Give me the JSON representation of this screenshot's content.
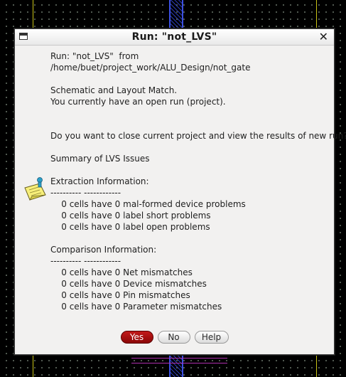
{
  "dialog": {
    "title": "Run: \"not_LVS\"",
    "lines": [
      "Run: \"not_LVS\"  from",
      "/home/buet/project_work/ALU_Design/not_gate",
      "",
      "Schematic and Layout Match.",
      "You currently have an open run (project).",
      "",
      "",
      "Do you want to close current project and view the results of new run?",
      "",
      "Summary of LVS Issues",
      "",
      "Extraction Information:",
      "---------- ------------",
      "    0 cells have 0 mal-formed device problems",
      "    0 cells have 0 label short problems",
      "    0 cells have 0 label open problems",
      "",
      "Comparison Information:",
      "---------- ------------",
      "    0 cells have 0 Net mismatches",
      "    0 cells have 0 Device mismatches",
      "    0 cells have 0 Pin mismatches",
      "    0 cells have 0 Parameter mismatches"
    ],
    "buttons": {
      "yes": "Yes",
      "no": "No",
      "help": "Help"
    }
  },
  "colors": {
    "yes_button": "#a80f0f",
    "background": "#000000",
    "boundary": "#c9c316",
    "metal_blue": "#3b4fe0"
  },
  "icons": {
    "window_menu": "window-menu-icon",
    "close": "close-icon",
    "info": "info-icon"
  }
}
